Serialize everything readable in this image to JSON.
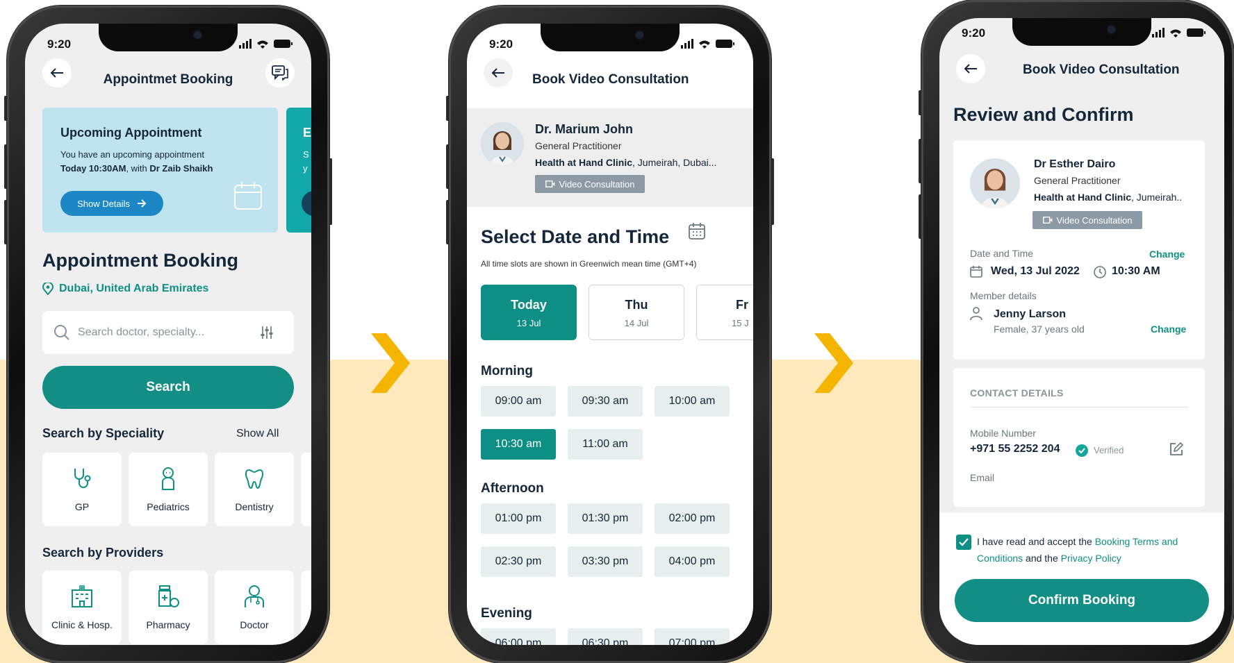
{
  "status_time": "9:20",
  "phone1": {
    "title": "Appointmet Booking",
    "upcoming": {
      "title": "Upcoming Appointment",
      "line1": "You have an upcoming appointment",
      "line2_bold": "Today 10:30AM",
      "line2_mid": ", with ",
      "line2_doctor": "Dr Zaib Shaikh",
      "button": "Show Details"
    },
    "next_card_initial": "E",
    "next_card_lines": [
      "S",
      "y"
    ],
    "section_title": "Appointment Booking",
    "location": "Dubai, United Arab Emirates",
    "search_placeholder": "Search doctor, specialty...",
    "search_button": "Search",
    "speciality": {
      "title": "Search by Speciality",
      "show_all": "Show All",
      "items": [
        {
          "label": "GP",
          "icon": "stethoscope-icon"
        },
        {
          "label": "Pediatrics",
          "icon": "baby-icon"
        },
        {
          "label": "Dentistry",
          "icon": "tooth-icon"
        }
      ]
    },
    "providers": {
      "title": "Search by Providers",
      "items": [
        {
          "label": "Clinic & Hosp.",
          "icon": "hospital-icon"
        },
        {
          "label": "Pharmacy",
          "icon": "pharmacy-icon"
        },
        {
          "label": "Doctor",
          "icon": "doctor-icon"
        }
      ]
    }
  },
  "phone2": {
    "title": "Book Video Consultation",
    "doctor": {
      "name": "Dr. Marium John",
      "role": "General Practitioner",
      "clinic_bold": "Health at Hand Clinic",
      "clinic_rest": ", Jumeirah, Dubai...",
      "badge": "Video Consultation"
    },
    "section_title": "Select Date and Time",
    "tz_note": "All time slots are shown in Greenwich mean time (GMT+4)",
    "days": [
      {
        "name": "Today",
        "date": "13 Jul",
        "selected": true
      },
      {
        "name": "Thu",
        "date": "14 Jul",
        "selected": false
      },
      {
        "name": "Fr",
        "date": "15 J",
        "selected": false
      }
    ],
    "morning": {
      "title": "Morning",
      "slots": [
        "09:00 am",
        "09:30 am",
        "10:00 am",
        "10:30 am",
        "11:00 am"
      ],
      "selected": "10:30 am"
    },
    "afternoon": {
      "title": "Afternoon",
      "slots": [
        "01:00 pm",
        "01:30 pm",
        "02:00 pm",
        "02:30 pm",
        "03:30 pm",
        "04:00 pm"
      ]
    },
    "evening": {
      "title": "Evening",
      "slots": [
        "06:00 pm",
        "06:30 pm",
        "07:00 pm"
      ]
    }
  },
  "phone3": {
    "title": "Book Video Consultation",
    "heading": "Review and Confirm",
    "doctor": {
      "name": "Dr Esther Dairo",
      "role": "General Practitioner",
      "clinic_bold": "Health at Hand Clinic",
      "clinic_rest": ", Jumeirah..",
      "badge": "Video Consultation"
    },
    "date_label": "Date and Time",
    "change": "Change",
    "date": "Wed, 13 Jul 2022",
    "time": "10:30 AM",
    "member_label": "Member details",
    "member_name": "Jenny Larson",
    "member_info": "Female, 37 years old",
    "contact_title": "CONTACT DETAILS",
    "mobile_label": "Mobile Number",
    "mobile": "+971 55 2252 204",
    "verified": "Verified",
    "email_label": "Email",
    "terms_pre": "I have read and accept the ",
    "terms_link1": "Booking Terms and",
    "terms_link1b": "Conditions",
    "terms_mid": " and the ",
    "terms_link2": "Privacy Policy",
    "confirm_button": "Confirm Booking"
  },
  "colors": {
    "teal": "#0e8f86",
    "band": "#fde9bc",
    "chevron": "#f4b400",
    "blue_button": "#1b88c5"
  }
}
